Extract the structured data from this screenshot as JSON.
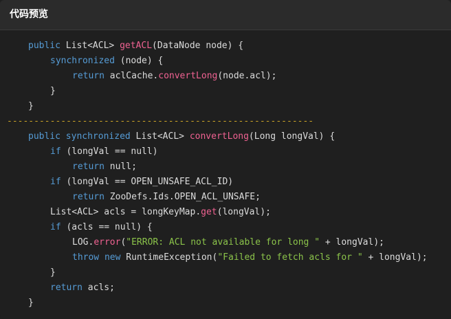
{
  "header": {
    "title": "代码预览"
  },
  "lines": [
    {
      "indent": "0",
      "tokens": [
        {
          "t": "public ",
          "c": "kw"
        },
        {
          "t": "List<ACL> ",
          "c": "plain"
        },
        {
          "t": "getACL",
          "c": "fn"
        },
        {
          "t": "(DataNode node) {",
          "c": "plain"
        }
      ]
    },
    {
      "indent": "1",
      "tokens": [
        {
          "t": "synchronized ",
          "c": "kw"
        },
        {
          "t": "(node) {",
          "c": "plain"
        }
      ]
    },
    {
      "indent": "2",
      "tokens": [
        {
          "t": "return ",
          "c": "kw"
        },
        {
          "t": "aclCache.",
          "c": "plain"
        },
        {
          "t": "convertLong",
          "c": "fn"
        },
        {
          "t": "(node.acl);",
          "c": "plain"
        }
      ]
    },
    {
      "indent": "1",
      "tokens": [
        {
          "t": "}",
          "c": "plain"
        }
      ]
    },
    {
      "indent": "0",
      "tokens": [
        {
          "t": "}",
          "c": "plain"
        }
      ]
    },
    {
      "indent": "sep",
      "tokens": [
        {
          "t": "---------------------------------------------------------",
          "c": "separator-line"
        }
      ]
    },
    {
      "indent": "0",
      "tokens": [
        {
          "t": "public ",
          "c": "kw"
        },
        {
          "t": "synchronized ",
          "c": "kw"
        },
        {
          "t": "List<ACL> ",
          "c": "plain"
        },
        {
          "t": "convertLong",
          "c": "fn"
        },
        {
          "t": "(Long longVal) {",
          "c": "plain"
        }
      ]
    },
    {
      "indent": "1",
      "tokens": [
        {
          "t": "if ",
          "c": "kw"
        },
        {
          "t": "(longVal == null)",
          "c": "plain"
        }
      ]
    },
    {
      "indent": "2",
      "tokens": [
        {
          "t": "return ",
          "c": "kw"
        },
        {
          "t": "null;",
          "c": "plain"
        }
      ]
    },
    {
      "indent": "1",
      "tokens": [
        {
          "t": "if ",
          "c": "kw"
        },
        {
          "t": "(longVal == OPEN_UNSAFE_ACL_ID)",
          "c": "plain"
        }
      ]
    },
    {
      "indent": "2",
      "tokens": [
        {
          "t": "return ",
          "c": "kw"
        },
        {
          "t": "ZooDefs.Ids.OPEN_ACL_UNSAFE;",
          "c": "plain"
        }
      ]
    },
    {
      "indent": "1",
      "tokens": [
        {
          "t": "List<ACL> acls = longKeyMap.",
          "c": "plain"
        },
        {
          "t": "get",
          "c": "fn"
        },
        {
          "t": "(longVal);",
          "c": "plain"
        }
      ]
    },
    {
      "indent": "1",
      "tokens": [
        {
          "t": "if ",
          "c": "kw"
        },
        {
          "t": "(acls == null) {",
          "c": "plain"
        }
      ]
    },
    {
      "indent": "2",
      "tokens": [
        {
          "t": "LOG.",
          "c": "plain"
        },
        {
          "t": "error",
          "c": "fn"
        },
        {
          "t": "(",
          "c": "plain"
        },
        {
          "t": "\"ERROR: ACL not available for long \"",
          "c": "str"
        },
        {
          "t": " + longVal);",
          "c": "plain"
        }
      ]
    },
    {
      "indent": "2",
      "tokens": [
        {
          "t": "throw ",
          "c": "kw"
        },
        {
          "t": "new ",
          "c": "kw"
        },
        {
          "t": "RuntimeException(",
          "c": "plain"
        },
        {
          "t": "\"Failed to fetch acls for \"",
          "c": "str"
        },
        {
          "t": " + longVal);",
          "c": "plain"
        }
      ]
    },
    {
      "indent": "1",
      "tokens": [
        {
          "t": "}",
          "c": "plain"
        }
      ]
    },
    {
      "indent": "1",
      "tokens": [
        {
          "t": "return ",
          "c": "kw"
        },
        {
          "t": "acls;",
          "c": "plain"
        }
      ]
    },
    {
      "indent": "0",
      "tokens": [
        {
          "t": "}",
          "c": "plain"
        }
      ]
    }
  ],
  "colors": {
    "background": "#1f1f1f",
    "header_background": "#2b2b2b",
    "keyword": "#569cd6",
    "method": "#f06292",
    "string": "#8bc34a",
    "text": "#dcdcdc",
    "separator": "#c9a227"
  }
}
